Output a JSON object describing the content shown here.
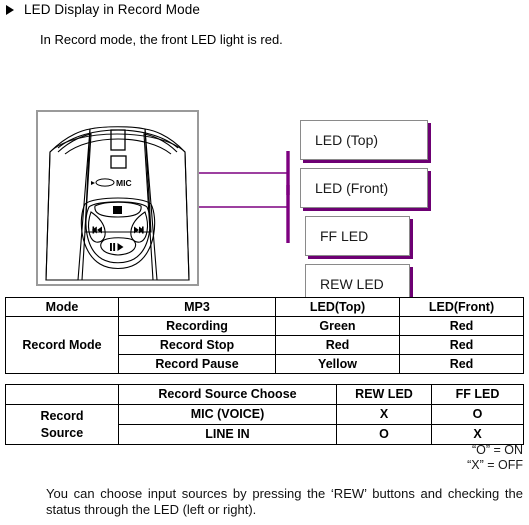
{
  "heading": {
    "bullet_icon": "triangle-right-icon",
    "title": "LED Display in Record Mode"
  },
  "intro": {
    "text": "In Record mode, the front LED light is red."
  },
  "figure": {
    "device_label_mic": "MIC",
    "buttons": {
      "stop": "stop-button-icon",
      "rew": "rewind-button-icon",
      "ff": "fast-forward-button-icon",
      "play_pause": "play-pause-button-icon"
    },
    "callouts": [
      {
        "id": "led-top",
        "label": "LED (Top)"
      },
      {
        "id": "led-front",
        "label": "LED (Front)"
      },
      {
        "id": "ff-led",
        "label": "FF LED"
      },
      {
        "id": "rew-led",
        "label": "REW LED"
      }
    ],
    "leader_color": "#7d0080",
    "frame_color": "#9a9a9a"
  },
  "table_record_mode": {
    "headers": [
      "Mode",
      "MP3",
      "LED(Top)",
      "LED(Front)"
    ],
    "row_label": "Record Mode",
    "rows": [
      {
        "mp3": "Recording",
        "led_top": "Green",
        "led_front": "Red"
      },
      {
        "mp3": "Record Stop",
        "led_top": "Red",
        "led_front": "Red"
      },
      {
        "mp3": "Record Pause",
        "led_top": "Yellow",
        "led_front": "Red"
      }
    ]
  },
  "table_record_source": {
    "headers": [
      "",
      "Record Source Choose",
      "REW LED",
      "FF LED"
    ],
    "row_label_line1": "Record",
    "row_label_line2": "Source",
    "rows": [
      {
        "source": "MIC (VOICE)",
        "rew_led": "X",
        "ff_led": "O"
      },
      {
        "source": "LINE IN",
        "rew_led": "O",
        "ff_led": "X"
      }
    ]
  },
  "legend": {
    "line1": "“O” = ON",
    "line2": "“X” = OFF"
  },
  "footer": {
    "text": "You can choose input sources by pressing the ‘REW’ buttons and checking the status through the LED (left or right)."
  }
}
